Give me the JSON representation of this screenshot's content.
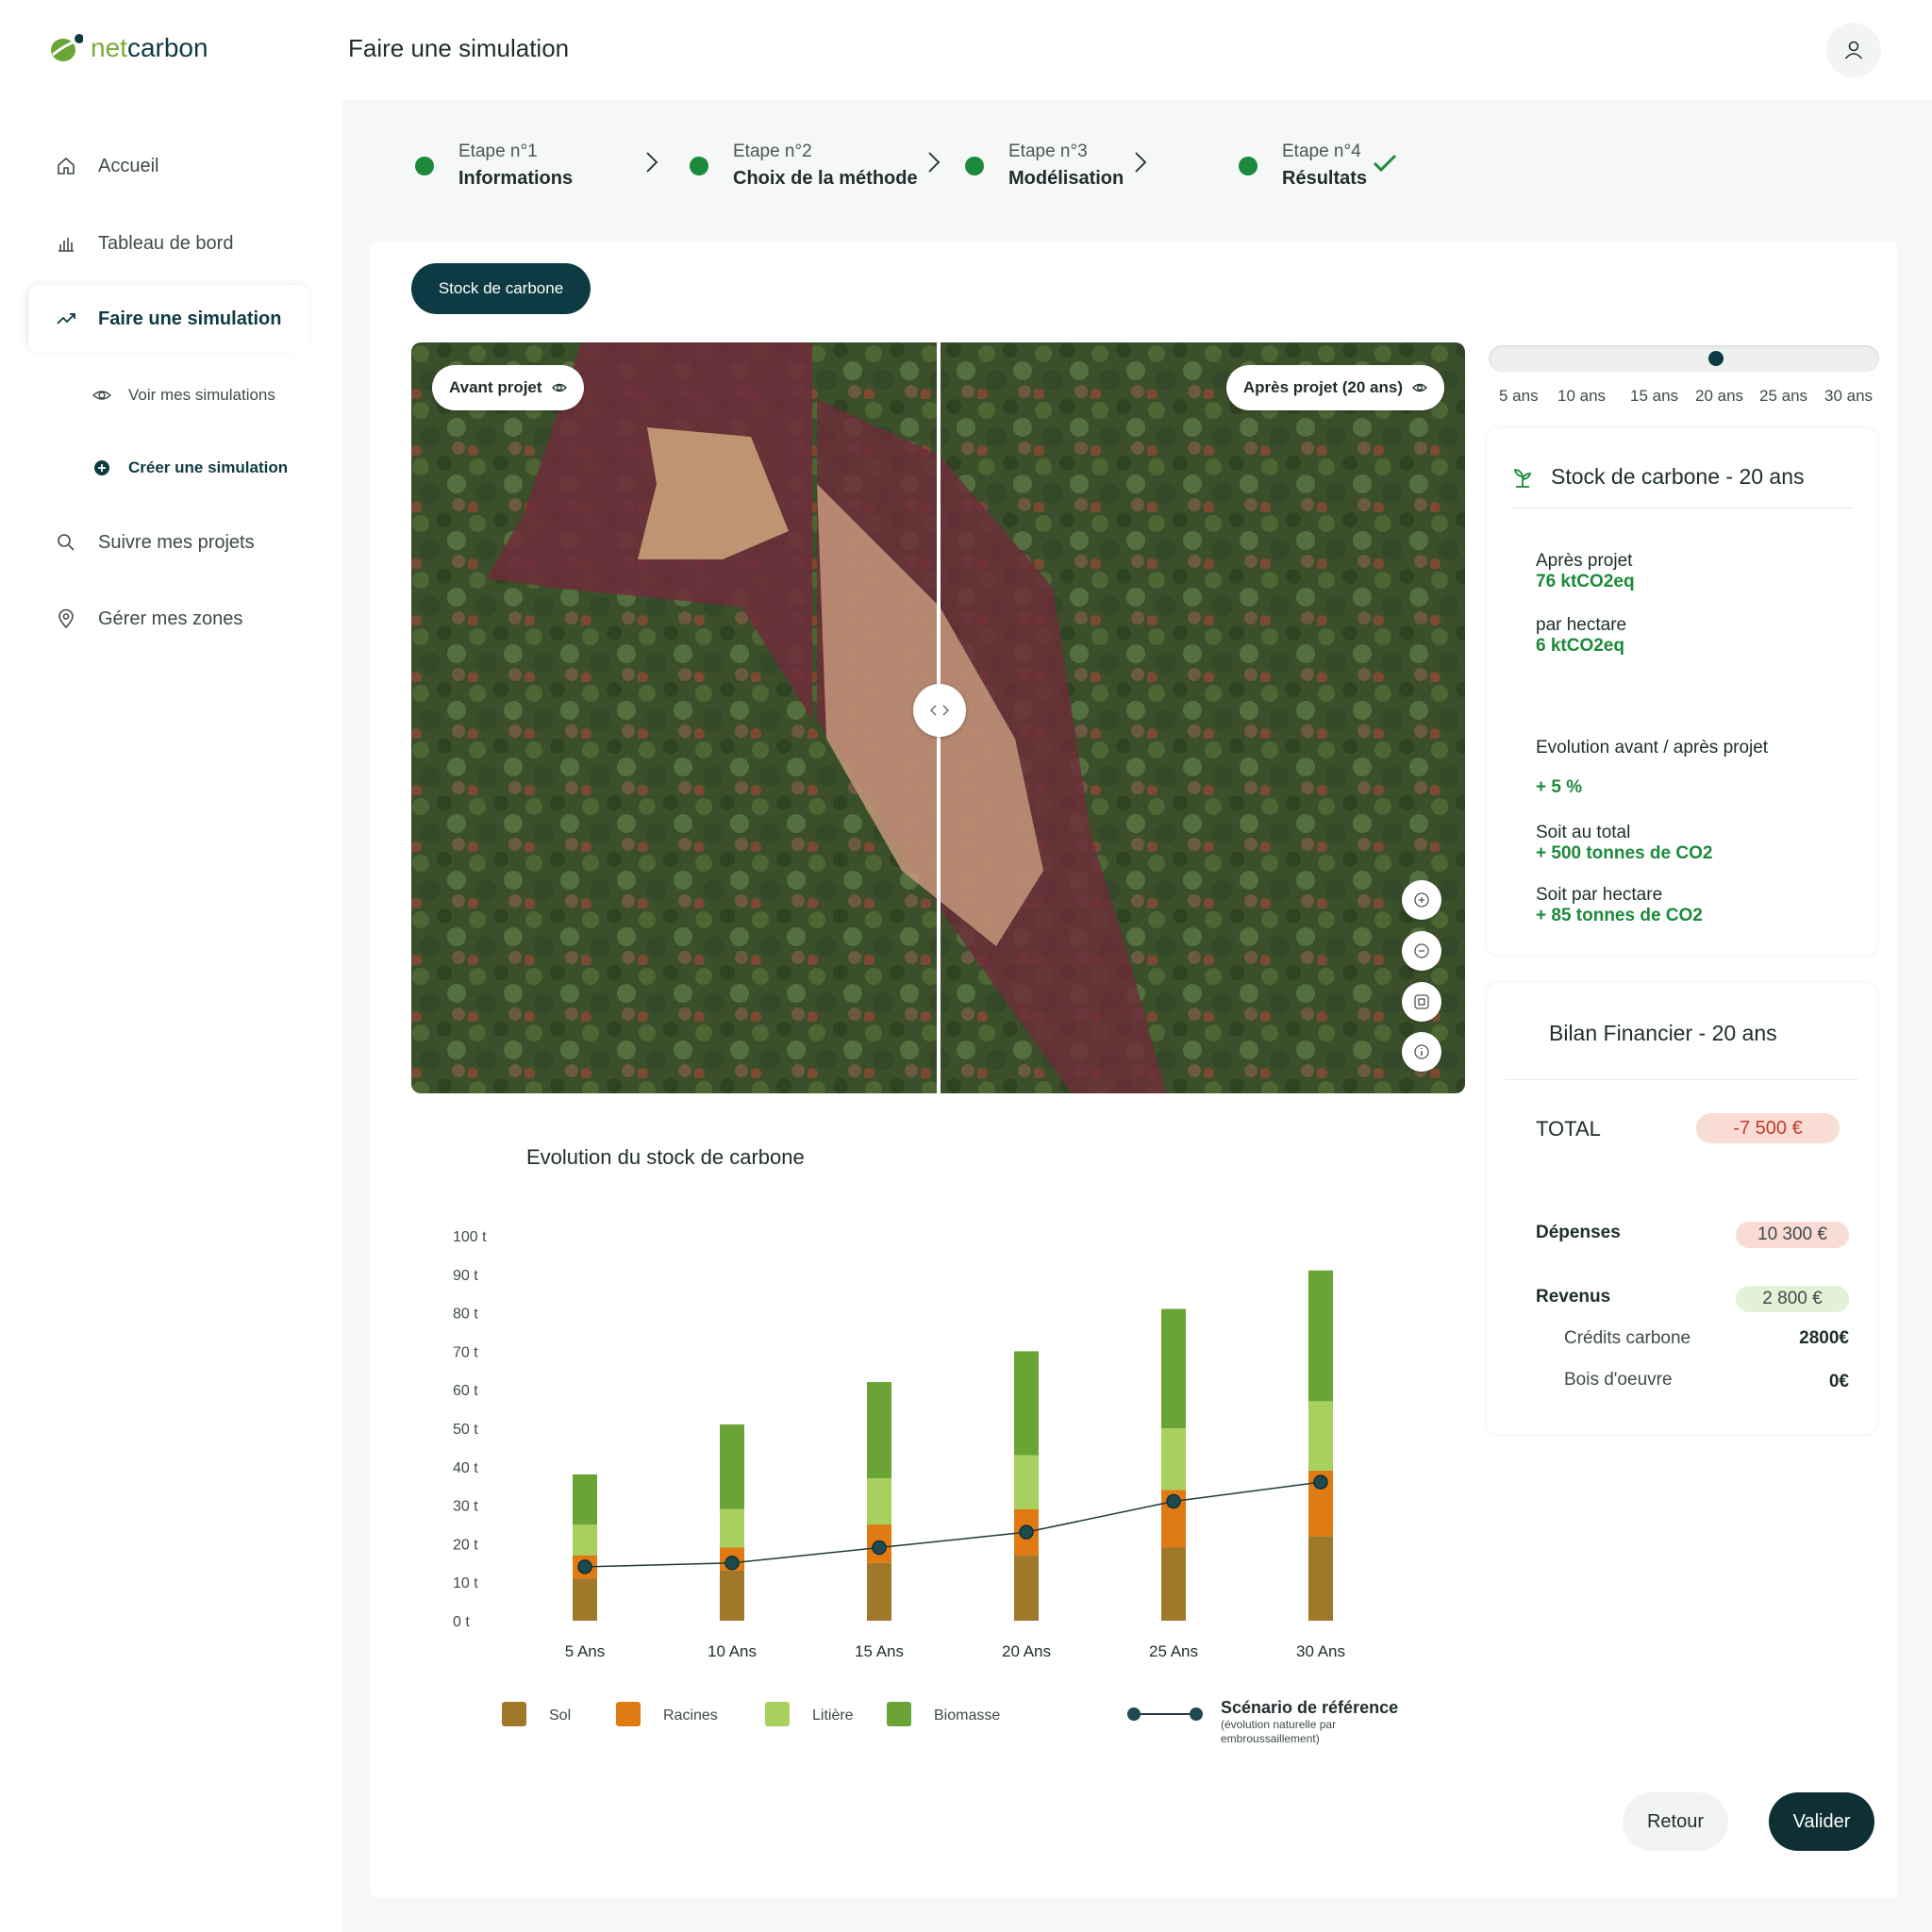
{
  "brand": {
    "logo_prefix": "net",
    "logo_suffix": "carbon"
  },
  "header": {
    "title": "Faire une simulation"
  },
  "sidebar": {
    "items": [
      {
        "label": "Accueil"
      },
      {
        "label": "Tableau de bord"
      },
      {
        "label": "Faire une simulation"
      },
      {
        "label": "Suivre mes projets"
      },
      {
        "label": "Gérer mes zones"
      }
    ],
    "subitems": [
      {
        "label": "Voir mes simulations"
      },
      {
        "label": "Créer une simulation"
      }
    ]
  },
  "stepper": [
    {
      "num": "Etape n°1",
      "name": "Informations"
    },
    {
      "num": "Etape n°2",
      "name": "Choix de la méthode"
    },
    {
      "num": "Etape n°3",
      "name": "Modélisation"
    },
    {
      "num": "Etape n°4",
      "name": "Résultats"
    }
  ],
  "tab_button": "Stock de carbone",
  "map": {
    "before_label": "Avant projet",
    "after_label": "Après projet (20 ans)"
  },
  "slider": {
    "labels": [
      "5 ans",
      "10 ans",
      "15 ans",
      "20 ans",
      "25 ans",
      "30 ans"
    ],
    "selected": "20 ans"
  },
  "stock_card": {
    "title": "Stock de carbone - 20 ans",
    "after_label": "Après projet",
    "after_value": "76 ktCO2eq",
    "per_ha_label": "par hectare",
    "per_ha_value": "6 ktCO2eq",
    "evolution_label": "Evolution avant / après projet",
    "evolution_value": "+ 5 %",
    "total_label": "Soit au total",
    "total_value": "+ 500 tonnes de CO2",
    "per_ha2_label": "Soit par hectare",
    "per_ha2_value": "+ 85 tonnes de CO2"
  },
  "finance_card": {
    "title": "Bilan Financier - 20 ans",
    "total_label": "TOTAL",
    "total_value": "-7 500 €",
    "expenses_label": "Dépenses",
    "expenses_value": "10 300 €",
    "revenue_label": "Revenus",
    "revenue_value": "2 800 €",
    "credits_label": "Crédits carbone",
    "credits_value": "2800€",
    "wood_label": "Bois d'oeuvre",
    "wood_value": "0€"
  },
  "chart_data": {
    "type": "bar",
    "title": "Evolution du stock de carbone",
    "categories": [
      "5 Ans",
      "10 Ans",
      "15 Ans",
      "20 Ans",
      "25 Ans",
      "30 Ans"
    ],
    "y_ticks": [
      "0 t",
      "10 t",
      "20 t",
      "30 t",
      "40 t",
      "50 t",
      "60 t",
      "70 t",
      "80 t",
      "90 t",
      "100 t"
    ],
    "ylim": [
      0,
      100
    ],
    "stacked": true,
    "series": [
      {
        "name": "Sol",
        "color": "#a0782a",
        "values": [
          11,
          13,
          15,
          17,
          19,
          22
        ]
      },
      {
        "name": "Racines",
        "color": "#e07a12",
        "values": [
          6,
          6,
          10,
          12,
          15,
          17
        ]
      },
      {
        "name": "Litière",
        "color": "#a8d05f",
        "values": [
          8,
          10,
          12,
          14,
          16,
          18
        ]
      },
      {
        "name": "Biomasse",
        "color": "#6aa436",
        "values": [
          13,
          22,
          25,
          27,
          31,
          34
        ]
      }
    ],
    "line": {
      "name": "Scénario de référence",
      "note": "(évolution naturelle par embroussaillement)",
      "color": "#1e3a3e",
      "values": [
        14,
        15,
        19,
        23,
        31,
        36
      ]
    },
    "grid": false,
    "legend_position": "bottom"
  }
}
